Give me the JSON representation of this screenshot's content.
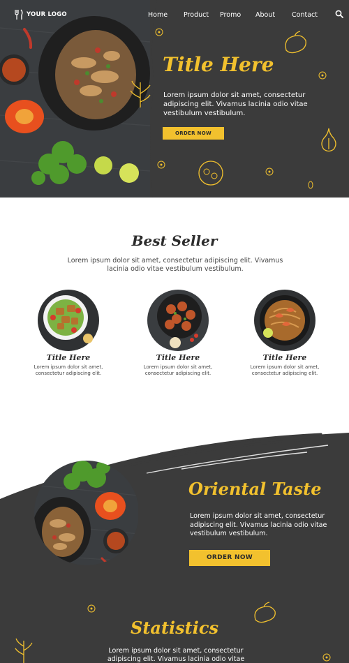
{
  "brand": {
    "logo_text": "YOUR LOGO"
  },
  "nav": {
    "items": [
      "Home",
      "Product",
      "Promo",
      "About",
      "Contact"
    ]
  },
  "hero": {
    "title": "Title Here",
    "text": "Lorem ipsum dolor sit amet, consectetur adipiscing elit. Vivamus lacinia odio vitae vestibulum vestibulum.",
    "button": "ORDER NOW"
  },
  "best_seller": {
    "title": "Best Seller",
    "text": "Lorem ipsum dolor sit amet, consectetur adipiscing elit. Vivamus lacinia odio vitae vestibulum vestibulum.",
    "items": [
      {
        "title": "Title Here",
        "text": "Lorem ipsum dolor sit amet, consectetur adipiscing elit."
      },
      {
        "title": "Title Here",
        "text": "Lorem ipsum dolor sit amet, consectetur adipiscing elit."
      },
      {
        "title": "Title Here",
        "text": "Lorem ipsum dolor sit amet, consectetur adipiscing elit."
      }
    ]
  },
  "oriental": {
    "title": "Oriental Taste",
    "text": "Lorem ipsum dolor sit amet, consectetur adipiscing elit. Vivamus lacinia odio vitae vestibulum vestibulum.",
    "button": "ORDER NOW"
  },
  "statistics": {
    "title": "Statistics",
    "text": "Lorem ipsum dolor sit amet, consectetur adipiscing elit. Vivamus lacinia odio vitae vestibulum vestibulum."
  },
  "colors": {
    "accent": "#f2c12e",
    "dark": "#3b3b3b",
    "light": "#ffffff"
  }
}
